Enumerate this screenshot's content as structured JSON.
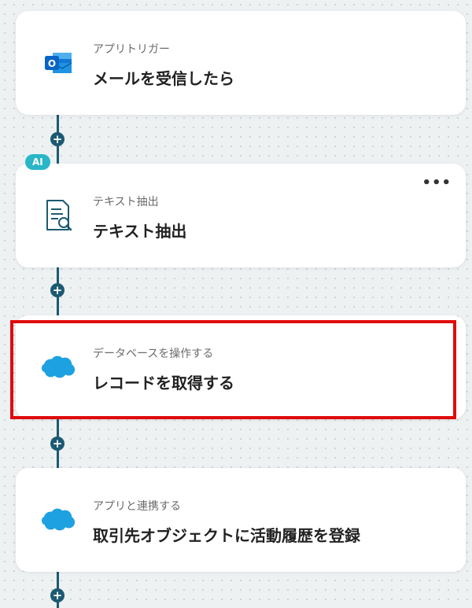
{
  "flow": {
    "steps": [
      {
        "label": "アプリトリガー",
        "title": "メールを受信したら",
        "icon": "outlook-icon",
        "ai": false
      },
      {
        "label": "テキスト抽出",
        "title": "テキスト抽出",
        "icon": "document-search-icon",
        "ai": true,
        "badge": "AI",
        "more": "•••"
      },
      {
        "label": "データベースを操作する",
        "title": "レコードを取得する",
        "icon": "salesforce-icon",
        "ai": false,
        "highlighted": true
      },
      {
        "label": "アプリと連携する",
        "title": "取引先オブジェクトに活動履歴を登録",
        "icon": "salesforce-icon",
        "ai": false
      }
    ],
    "add_symbol": "+"
  },
  "colors": {
    "connector": "#1b5a72",
    "ai_badge": "#2ab6c8",
    "highlight_border": "#e00b0b",
    "outlook_blue": "#0a64c6",
    "salesforce_blue": "#1ea1e0"
  }
}
